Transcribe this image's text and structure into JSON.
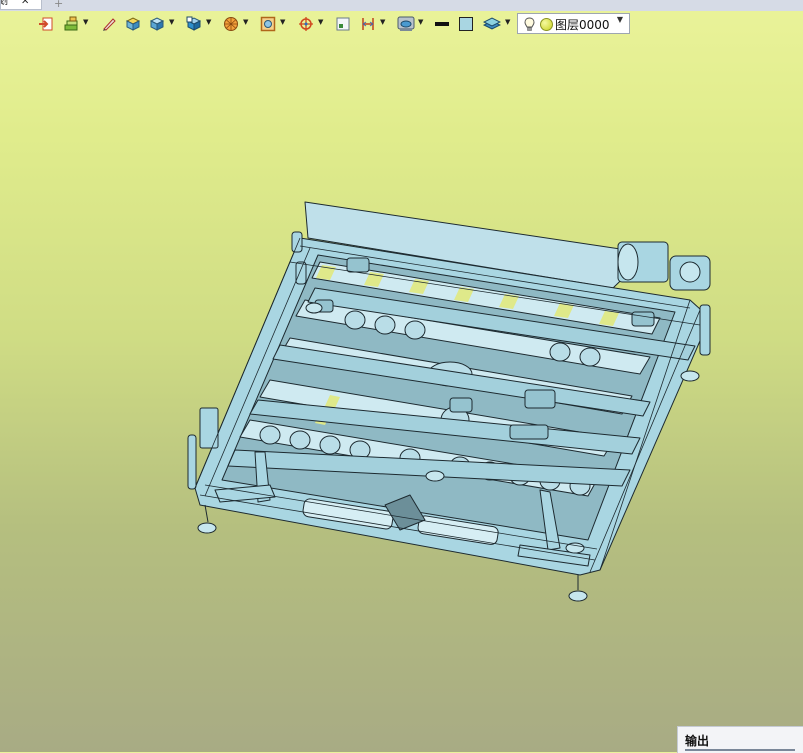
{
  "tabs": {
    "active_label": "划",
    "close_glyph": "✕",
    "new_tab_glyph": "+"
  },
  "toolbar": {
    "items": [
      {
        "icon": "exit-icon",
        "has_dropdown": false
      },
      {
        "icon": "layers-tree-icon",
        "has_dropdown": true
      },
      {
        "icon": "pen-icon",
        "has_dropdown": false
      },
      {
        "icon": "box-yellow-icon",
        "has_dropdown": false
      },
      {
        "icon": "cube-blue-icon",
        "has_dropdown": true
      },
      {
        "icon": "cube-render-icon",
        "has_dropdown": true
      },
      {
        "icon": "sphere-orange-icon",
        "has_dropdown": true
      },
      {
        "icon": "frame-orange-icon",
        "has_dropdown": true
      },
      {
        "icon": "target-icon",
        "has_dropdown": true
      },
      {
        "icon": "view-frame-icon",
        "has_dropdown": false
      },
      {
        "icon": "dimension-icon",
        "has_dropdown": true
      },
      {
        "icon": "render-style-icon",
        "has_dropdown": true
      },
      {
        "icon": "line-black-icon",
        "has_dropdown": false
      },
      {
        "icon": "fill-color-icon",
        "has_dropdown": false
      },
      {
        "icon": "layer-stack-icon",
        "has_dropdown": true
      }
    ]
  },
  "layer_select": {
    "value": "图层0000"
  },
  "output_panel": {
    "title": "输出"
  },
  "colors": {
    "model_fill": "#a9d6e2",
    "model_stroke": "#1d2a30",
    "background_top": "#eaf39a",
    "background_bottom": "#a8ab84"
  }
}
